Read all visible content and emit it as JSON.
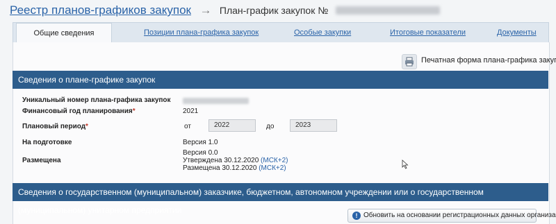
{
  "breadcrumb": {
    "root": "Реестр планов-графиков закупок",
    "current": "План-график закупок №"
  },
  "tabs": [
    {
      "label": "Общие сведения"
    },
    {
      "label": "Позиции плана-графика закупок"
    },
    {
      "label": "Особые закупки"
    },
    {
      "label": "Итоговые показатели"
    },
    {
      "label": "Документы"
    }
  ],
  "print_form": {
    "label": "Печатная форма плана-графика закупок",
    "icon": "printer-icon"
  },
  "plan_info": {
    "title": "Сведения о плане-графике закупок",
    "unique_number_label": "Уникальный номер плана-графика закупок",
    "fin_year_label": "Финансовый год планирования",
    "fin_year_value": "2021",
    "period_label": "Плановый период",
    "period_from_label": "от",
    "period_from_value": "2022",
    "period_to_label": "до",
    "period_to_value": "2023",
    "in_prep_label": "На подготовке",
    "in_prep_value": "Версия 1.0",
    "placed_label": "Размещена",
    "placed_version": "Версия 0.0",
    "approved_text": "Утверждена 30.12.2020",
    "approved_tz": "(МСК+2)",
    "placed_text": "Размещена 30.12.2020",
    "placed_tz": "(МСК+2)",
    "required_mark": "*"
  },
  "customer_info": {
    "title": "Сведения о государственном (муниципальном) заказчике, бюджетном, автономном учреждении или о государственном (муниципальном) унитарном предприятии",
    "refresh_button": "Обновить на основании регистрационных данных организации",
    "info_icon_glyph": "!"
  }
}
